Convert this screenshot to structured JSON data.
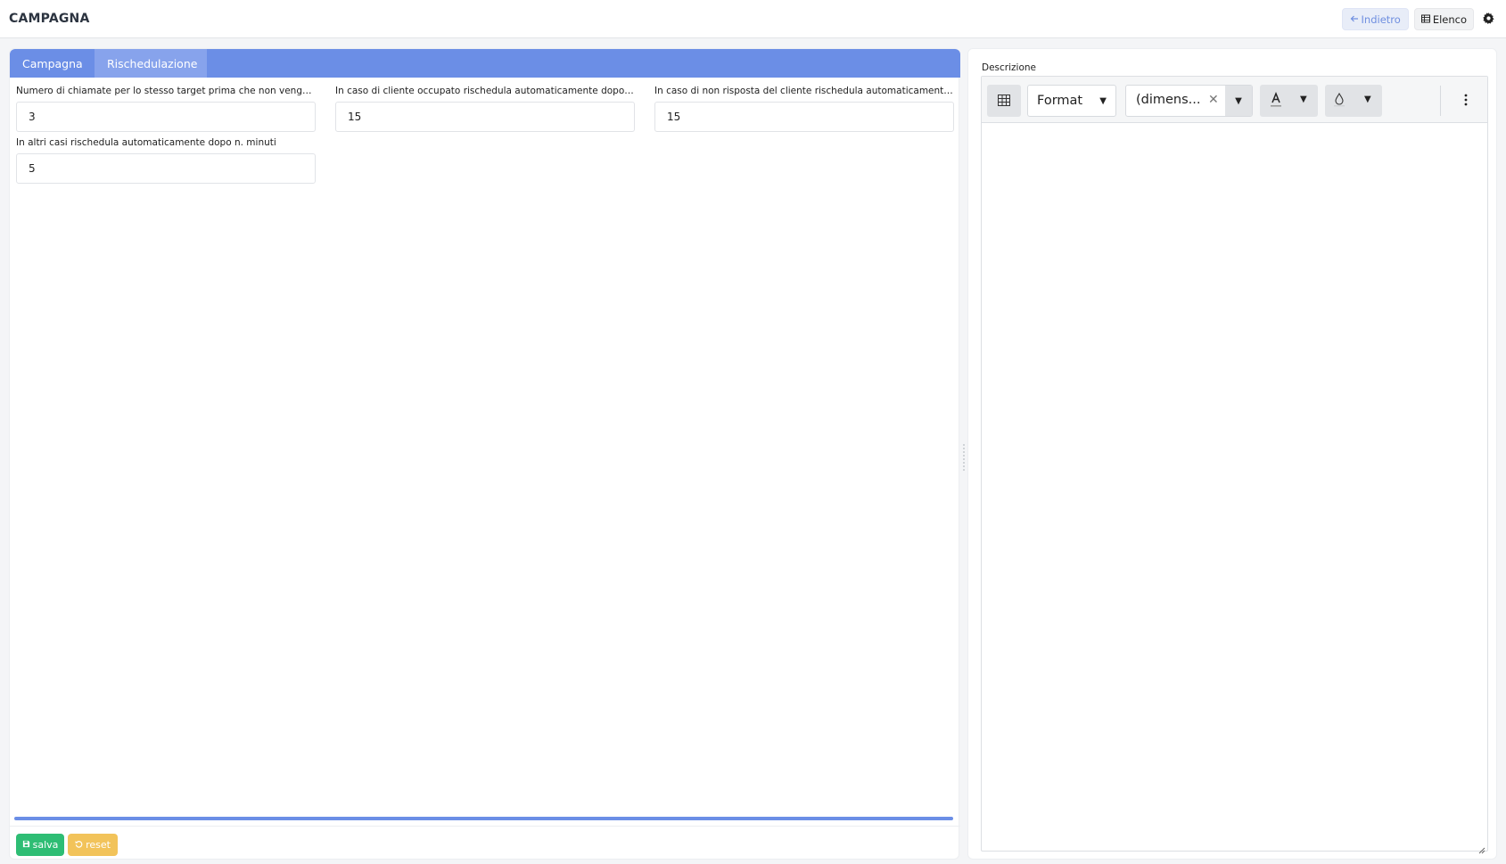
{
  "app": {
    "title": "CAMPAGNA"
  },
  "header": {
    "back_label": "Indietro",
    "list_label": "Elenco",
    "icons": {
      "back": "arrow-left-icon",
      "list": "table-icon",
      "settings": "gear-icon"
    }
  },
  "tabs": [
    {
      "label": "Campagna",
      "active": false
    },
    {
      "label": "Rischedulazione",
      "active": true
    }
  ],
  "fields": [
    {
      "label": "Numero di chiamate per lo stesso target prima che non venga più ...",
      "value": "3"
    },
    {
      "label": "In caso di cliente occupato rischedula automaticamente dopo n. ...",
      "value": "15"
    },
    {
      "label": "In caso di non risposta del cliente rischedula automaticamente do...",
      "value": "15"
    },
    {
      "label": "In altri casi rischedula automaticamente dopo n. minuti",
      "value": "5"
    }
  ],
  "actions": {
    "save_label": "salva",
    "reset_label": "reset"
  },
  "editor": {
    "label": "Descrizione",
    "format_label": "Format",
    "size_label": "(dimens...",
    "content": ""
  },
  "colors": {
    "accent": "#6b8ee6",
    "tab_active": "#87a3ec",
    "save": "#2ebd74",
    "reset": "#f2c35a",
    "back_text": "#6f8fe0"
  }
}
